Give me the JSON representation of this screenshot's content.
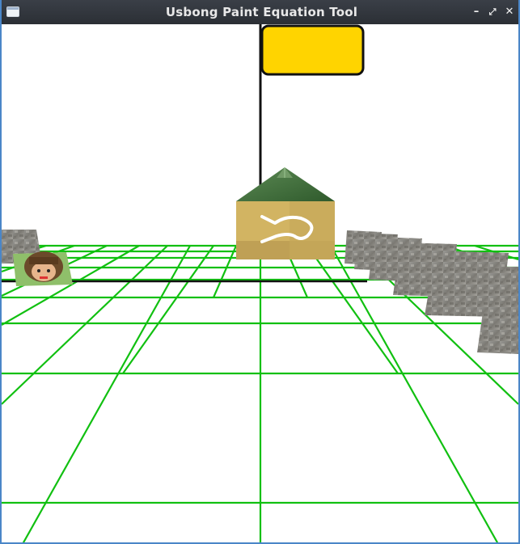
{
  "window": {
    "title": "Usbong Paint Equation Tool",
    "controls": [
      {
        "name": "minimize",
        "glyph": "–"
      },
      {
        "name": "maximize",
        "glyph": "⤢"
      },
      {
        "name": "close",
        "glyph": "✕"
      }
    ]
  },
  "scene": {
    "background_color": "#ffffff",
    "grid_color": "#11c011",
    "sign_color": "#ffd400",
    "pole_color": "#111111",
    "house": {
      "roof_color": "#3f6b3a",
      "wall_color": "#d2b462",
      "symbol": "hiragana-like white stroke"
    },
    "objects": [
      "signboard",
      "signpost",
      "house",
      "stone-wall-blocks",
      "character-portrait-tile"
    ]
  }
}
